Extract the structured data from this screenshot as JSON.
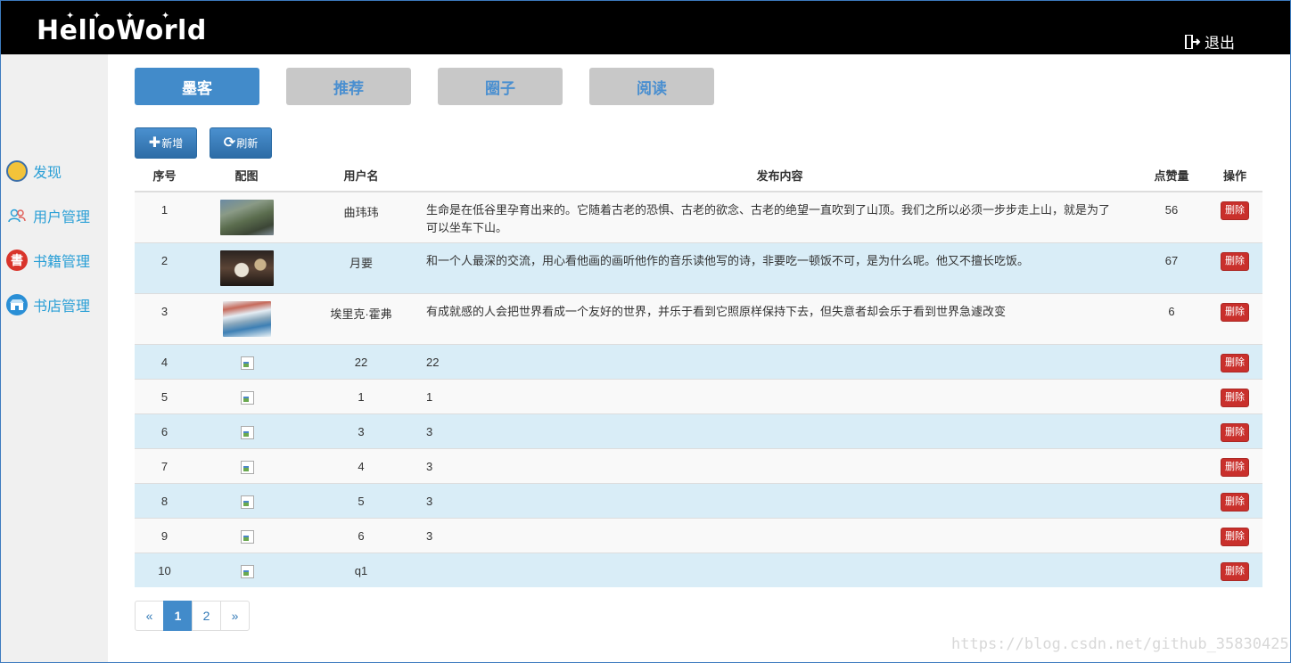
{
  "header": {
    "logo_text": "HelloWorld",
    "logout_label": "退出"
  },
  "sidebar": {
    "items": [
      {
        "label": "发现",
        "icon": "compass-icon"
      },
      {
        "label": "用户管理",
        "icon": "users-icon"
      },
      {
        "label": "书籍管理",
        "icon": "book-icon"
      },
      {
        "label": "书店管理",
        "icon": "store-icon"
      }
    ]
  },
  "tabs": [
    {
      "label": "墨客",
      "active": true
    },
    {
      "label": "推荐",
      "active": false
    },
    {
      "label": "圈子",
      "active": false
    },
    {
      "label": "阅读",
      "active": false
    }
  ],
  "toolbar": {
    "add_label": "新增",
    "refresh_label": "刷新"
  },
  "table": {
    "columns": [
      "序号",
      "配图",
      "用户名",
      "发布内容",
      "点赞量",
      "操作"
    ],
    "delete_label": "删除",
    "rows": [
      {
        "seq": "1",
        "image": "thumb1",
        "user": "曲玮玮",
        "content": "生命是在低谷里孕育出来的。它随着古老的恐惧、古老的欲念、古老的绝望一直吹到了山顶。我们之所以必须一步步走上山，就是为了可以坐车下山。",
        "likes": "56"
      },
      {
        "seq": "2",
        "image": "thumb2",
        "user": "月要",
        "content": "和一个人最深的交流，用心看他画的画听他作的音乐读他写的诗，非要吃一顿饭不可，是为什么呢。他又不擅长吃饭。",
        "likes": "67"
      },
      {
        "seq": "3",
        "image": "thumb3",
        "user": "埃里克·霍弗",
        "content": "有成就感的人会把世界看成一个友好的世界，并乐于看到它照原样保持下去，但失意者却会乐于看到世界急遽改变",
        "likes": "6"
      },
      {
        "seq": "4",
        "image": "broken",
        "user": "22",
        "content": "22",
        "likes": ""
      },
      {
        "seq": "5",
        "image": "broken",
        "user": "1",
        "content": "1",
        "likes": ""
      },
      {
        "seq": "6",
        "image": "broken",
        "user": "3",
        "content": "3",
        "likes": ""
      },
      {
        "seq": "7",
        "image": "broken",
        "user": "4",
        "content": "3",
        "likes": ""
      },
      {
        "seq": "8",
        "image": "broken",
        "user": "5",
        "content": "3",
        "likes": ""
      },
      {
        "seq": "9",
        "image": "broken",
        "user": "6",
        "content": "3",
        "likes": ""
      },
      {
        "seq": "10",
        "image": "broken",
        "user": "q1",
        "content": "",
        "likes": ""
      }
    ]
  },
  "pagination": {
    "prev": "«",
    "pages": [
      "1",
      "2"
    ],
    "current": "1",
    "next": "»"
  },
  "watermark": "https://blog.csdn.net/github_35830425",
  "colors": {
    "accent": "#428bca",
    "header_bg": "#000000",
    "sidebar_link": "#2a9fd6",
    "danger": "#c9302c",
    "row_alt": "#d9edf7"
  }
}
